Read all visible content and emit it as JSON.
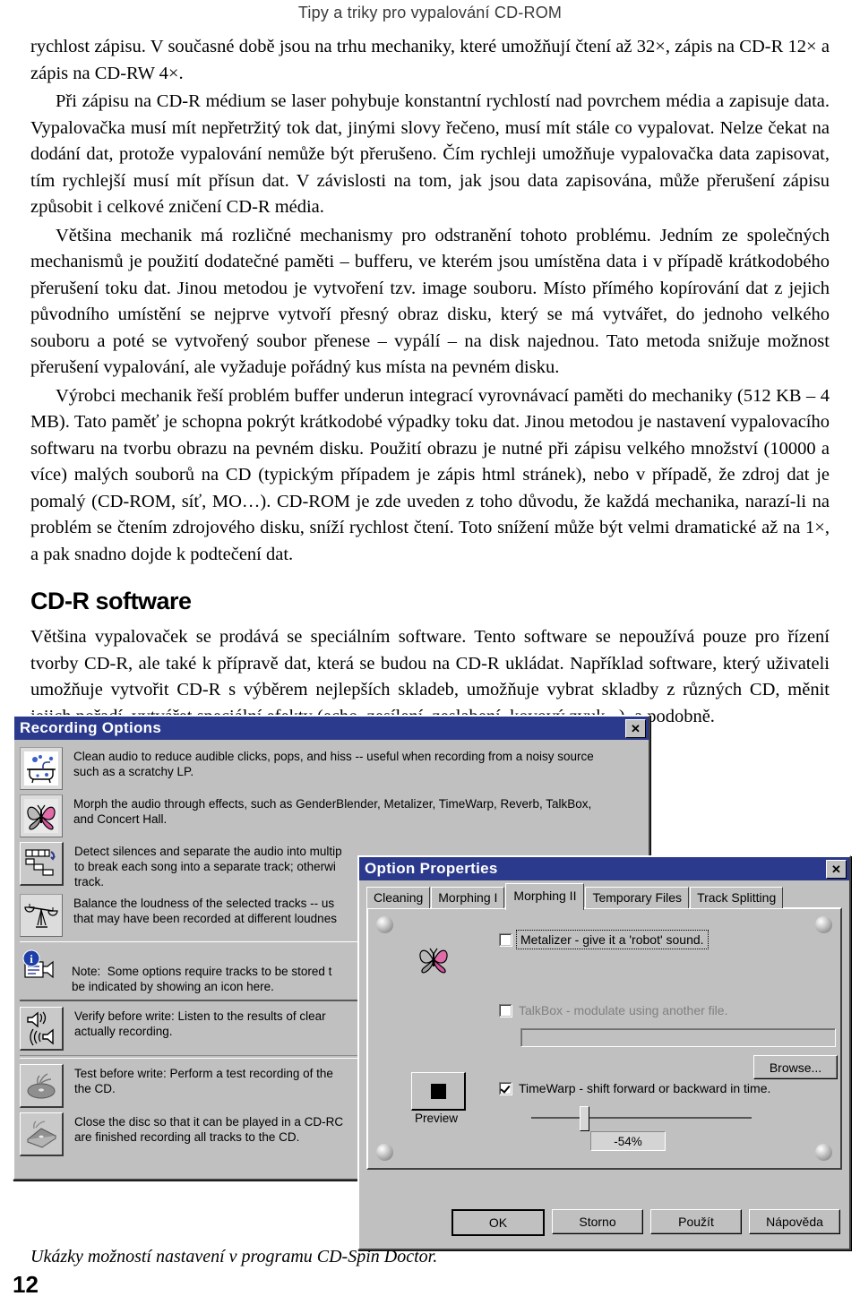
{
  "page": {
    "running_head": "Tipy a triky pro vypalování CD-ROM",
    "folio": "12",
    "caption": "Ukázky možností nastavení v programu CD-Spin Doctor."
  },
  "article": {
    "paragraphs": [
      "rychlost zápisu. V současné době jsou na trhu mechaniky, které umožňují čtení až 32×, zápis na CD-R 12× a zápis na CD-RW 4×.",
      "Při zápisu na CD-R médium se laser pohybuje konstantní rychlostí nad povrchem média a zapisuje data. Vypalovačka musí mít nepřetržitý tok dat, jinými slovy řečeno, musí mít stále co vypalovat. Nelze čekat na dodání dat, protože vypalování nemůže být přerušeno. Čím rychleji umožňuje vypalovačka data zapisovat, tím rychlejší musí mít přísun dat. V závislosti na tom, jak jsou data zapisována, může přerušení zápisu způsobit i celkové zničení CD-R média.",
      "Většina mechanik má rozličné mechanismy pro odstranění tohoto problému. Jedním ze společných mechanismů je použití dodatečné paměti – bufferu, ve kterém jsou umístěna data i v případě krátkodobého přerušení toku dat. Jinou metodou je vytvoření tzv. image souboru. Místo přímého kopírování dat z jejich původního umístění se nejprve vytvoří přesný obraz disku, který se má vytvářet, do jednoho velkého souboru a poté se vytvořený soubor přenese – vypálí – na disk najednou. Tato metoda snižuje možnost přerušení vypalování, ale vyžaduje pořádný kus místa na pevném disku.",
      "Výrobci mechanik řeší problém buffer underun integrací vyrovnávací paměti do mechaniky (512 KB – 4 MB). Tato paměť je schopna pokrýt krátkodobé výpadky toku dat. Jinou metodou je nastavení vypalovacího softwaru na tvorbu obrazu na pevném disku. Použití obrazu je nutné při zápisu velkého množství (10000 a více) malých souborů na CD (typickým případem je zápis html stránek), nebo v případě, že zdroj dat je pomalý (CD-ROM, síť, MO…). CD-ROM je zde uveden z toho důvodu, že každá mechanika, narazí-li na problém se čtením zdrojového disku, sníží rychlost čtení. Toto snížení může být velmi dramatické až na 1×, a pak snadno dojde k podtečení dat."
    ],
    "section_title": "CD-R software",
    "section_paragraph": "Většina vypalovaček se prodává se speciálním software. Tento software se nepoužívá pouze pro řízení tvorby CD-R, ale také k přípravě dat, která se budou na CD-R ukládat. Například software, který uživateli umožňuje vytvořit CD-R s výběrem nejlepších skladeb, umožňuje vybrat skladby z různých CD, měnit jejich pořadí, vytvářet speciální efekty (echo, zesílení, zeslabení, kovový zvuk...), a podobně."
  },
  "recording_options": {
    "title": "Recording Options",
    "close_label": "✕",
    "options": [
      {
        "icon": "bathtub-icon",
        "text": "Clean audio to reduce audible clicks, pops, and hiss -- useful when recording from a noisy source\nsuch as a scratchy LP."
      },
      {
        "icon": "butterfly-icon",
        "text": "Morph the audio through effects, such as GenderBlender, Metalizer, TimeWarp, Reverb, TalkBox,\nand Concert Hall."
      },
      {
        "icon": "track-split-icon",
        "text": "Detect silences and separate the audio into multip\nto break each song into a separate track; otherwi\ntrack."
      },
      {
        "icon": "balance-scale-icon",
        "text": "Balance the loudness of the selected tracks -- us\nthat may have been recorded at different loudnes"
      }
    ],
    "note": {
      "icon": "info-speaker-icon",
      "label": "Note:",
      "text": "Some options require tracks to be stored t\nbe indicated by showing an icon here."
    },
    "options_after_note": [
      {
        "icon": "speaker-verify-icon",
        "text": "Verify before write:  Listen to the results of clear\nactually recording."
      },
      {
        "icon": "disc-test-icon",
        "text": "Test before write:  Perform a test recording of the\nthe CD."
      },
      {
        "icon": "disc-close-icon",
        "text": "Close the disc so that it can be played in a CD-RC\nare finished recording all tracks to the CD."
      }
    ]
  },
  "option_properties": {
    "title": "Option Properties",
    "close_label": "✕",
    "tabs": [
      {
        "label": "Cleaning",
        "active": false
      },
      {
        "label": "Morphing I",
        "active": false
      },
      {
        "label": "Morphing II",
        "active": true
      },
      {
        "label": "Temporary Files",
        "active": false
      },
      {
        "label": "Track Splitting",
        "active": false
      }
    ],
    "panel": {
      "effect_icon": "butterfly-icon",
      "metalizer": {
        "label": "Metalizer - give it a 'robot' sound.",
        "checked": false,
        "enabled": true
      },
      "talkbox": {
        "label": "TalkBox - modulate using another file.",
        "checked": false,
        "enabled": false
      },
      "talkbox_file_value": "",
      "browse_label": "Browse...",
      "preview_label": "Preview",
      "timewarp": {
        "label": "TimeWarp - shift forward or backward in time.",
        "checked": true,
        "enabled": true
      },
      "timewarp_value": "-54%",
      "timewarp_slider_percent": 29
    },
    "buttons": [
      {
        "label": "OK",
        "default": true
      },
      {
        "label": "Storno",
        "default": false
      },
      {
        "label": "Použít",
        "default": false
      },
      {
        "label": "Nápověda",
        "default": false
      }
    ]
  },
  "colors": {
    "titlebar": "#2b3a8c",
    "face": "#c0c0c0",
    "running_head": "#3a3a3a"
  }
}
